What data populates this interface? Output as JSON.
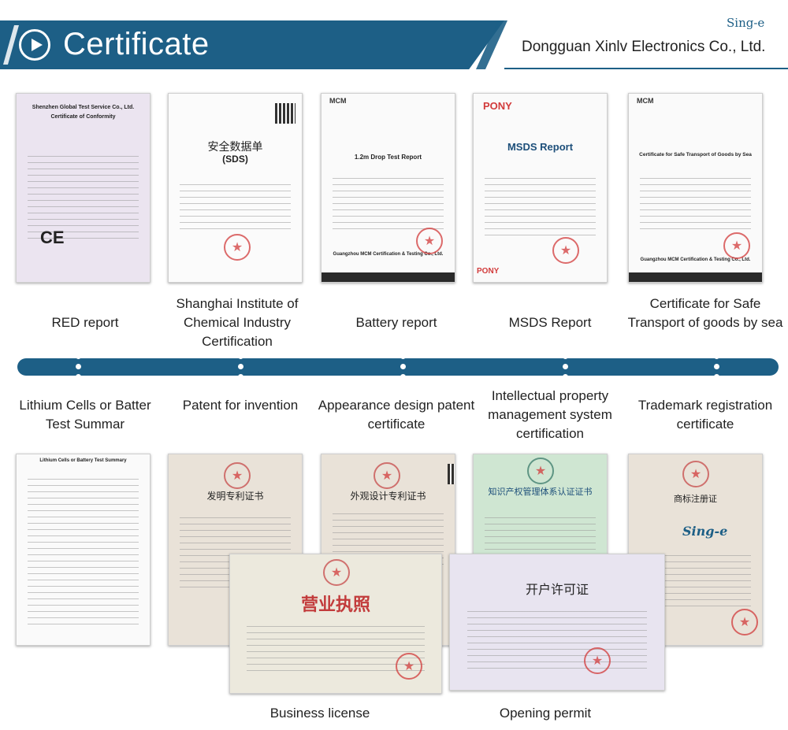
{
  "header": {
    "title": "Certificate",
    "logo_text": "Sing-e",
    "company": "Dongguan Xinlv Electronics Co., Ltd."
  },
  "colors": {
    "accent": "#1d5f86",
    "seal_red": "#d23b3b"
  },
  "top_row": [
    {
      "label": "RED report",
      "card_title": "Certificate of Conformity",
      "card_head": "Shenzhen Global Test Service Co., Ltd.",
      "card_mark": "CE"
    },
    {
      "label": "Shanghai Institute of Chemical Industry Certification",
      "card_title": "安全数据单",
      "card_head": "(SDS)",
      "card_mark": ""
    },
    {
      "label": "Battery report",
      "card_title": "1.2m Drop Test Report",
      "card_head": "Guangzhou MCM Certification & Testing Co., Ltd.",
      "card_mark": "MCM"
    },
    {
      "label": "MSDS Report",
      "card_title": "MSDS Report",
      "card_head": "PONY",
      "card_mark": "PONY"
    },
    {
      "label": "Certificate for Safe Transport of goods by sea",
      "card_title": "Certificate for Safe Transport of Goods by Sea",
      "card_head": "Guangzhou MCM Certification & Testing Co., Ltd.",
      "card_mark": "MCM"
    }
  ],
  "bottom_row": [
    {
      "label": "Lithium Cells or Batter Test Summar",
      "card_title": "Lithium Cells or Battery Test Summary"
    },
    {
      "label": "Patent for invention",
      "card_title": "发明专利证书"
    },
    {
      "label": "Appearance design patent certificate",
      "card_title": "外观设计专利证书"
    },
    {
      "label": "Intellectual property management system certification",
      "card_title": "知识产权管理体系认证证书"
    },
    {
      "label": "Trademark registration certificate",
      "card_title": "商标注册证",
      "card_mark": "Sing-e"
    }
  ],
  "overlay_row": [
    {
      "label": "Business license",
      "card_title": "营业执照"
    },
    {
      "label": "Opening permit",
      "card_title": "开户许可证"
    }
  ]
}
